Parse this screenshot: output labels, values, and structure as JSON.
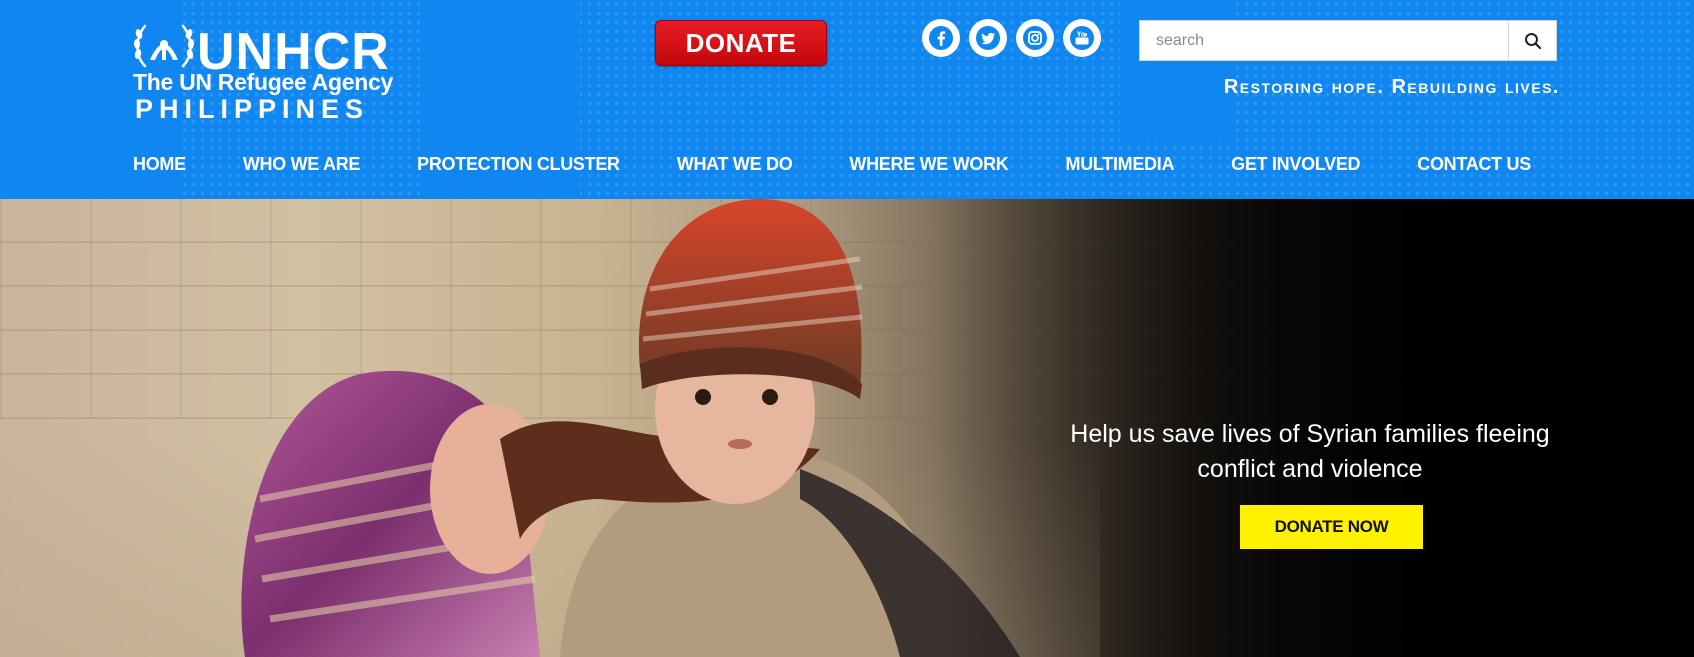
{
  "brand": {
    "name": "UNHCR",
    "tagline": "The UN Refugee Agency",
    "country": "PHILIPPINES",
    "emblem_icon": "unhcr-laurel-emblem-icon"
  },
  "header": {
    "donate_label": "DONATE",
    "slogan": "Restoring hope. Rebuilding lives.",
    "search": {
      "placeholder": "search",
      "value": "",
      "icon": "search-icon"
    },
    "social": [
      {
        "name": "facebook",
        "icon": "facebook-icon"
      },
      {
        "name": "twitter",
        "icon": "twitter-icon"
      },
      {
        "name": "instagram",
        "icon": "instagram-icon"
      },
      {
        "name": "youtube",
        "icon": "youtube-icon"
      }
    ],
    "bg_color": "#0f86f0"
  },
  "nav": {
    "items": [
      {
        "label": "HOME"
      },
      {
        "label": "WHO WE ARE"
      },
      {
        "label": "PROTECTION CLUSTER"
      },
      {
        "label": "WHAT WE DO"
      },
      {
        "label": "WHERE WE WORK"
      },
      {
        "label": "MULTIMEDIA"
      },
      {
        "label": "GET INVOLVED"
      },
      {
        "label": "CONTACT US"
      }
    ]
  },
  "hero": {
    "headline": "Help us save lives of Syrian families fleeing conflict and violence",
    "cta_label": "DONATE NOW",
    "cta_color": "#fff200"
  }
}
